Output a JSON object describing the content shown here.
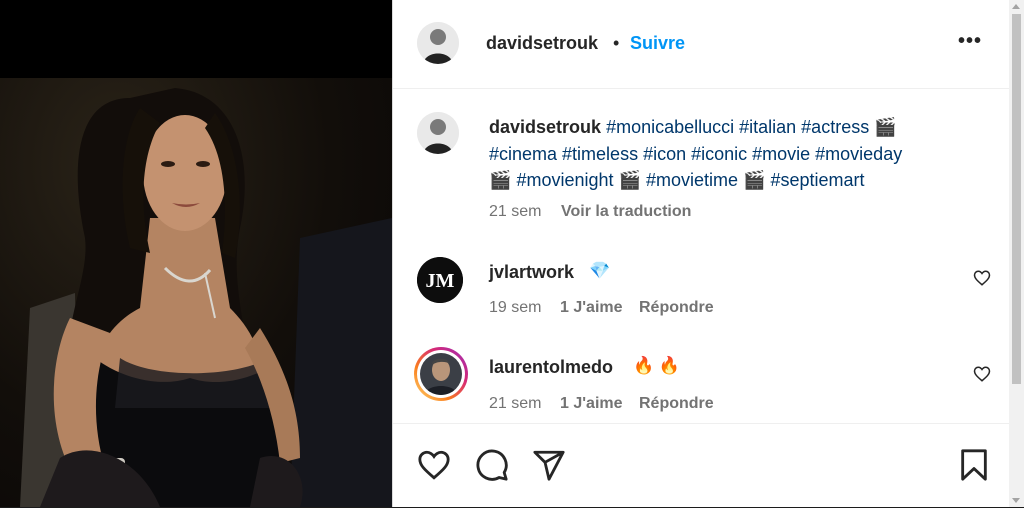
{
  "post": {
    "username": "davidsetrouk",
    "follow_label": "Suivre",
    "separator": "•",
    "more_label": "•••"
  },
  "caption": {
    "username": "davidsetrouk",
    "line1_tags": "#monicabellucci #italian #actress",
    "line2_tags": "#cinema #timeless #icon #iconic #movie #movieday",
    "tag_movienight": "#movienight",
    "tag_movietime": "#movietime",
    "tag_septiemart": "#septiemart",
    "emoji_clapper": "🎬",
    "time": "21 sem",
    "translate_label": "Voir la traduction"
  },
  "comments": [
    {
      "username": "jvlartwork",
      "emoji": "💎",
      "time": "19 sem",
      "likes": "1 J'aime",
      "reply_label": "Répondre",
      "avatar_text": "JM"
    },
    {
      "username": "laurentolmedo",
      "emoji": "🔥 🔥",
      "time": "21 sem",
      "likes": "1 J'aime",
      "reply_label": "Répondre"
    }
  ],
  "colors": {
    "link_blue": "#0095f6",
    "hashtag_blue": "#00376b",
    "muted": "#737373",
    "text": "#262626"
  },
  "icons": [
    "heart-icon",
    "comment-icon",
    "share-icon",
    "bookmark-icon",
    "more-icon"
  ]
}
